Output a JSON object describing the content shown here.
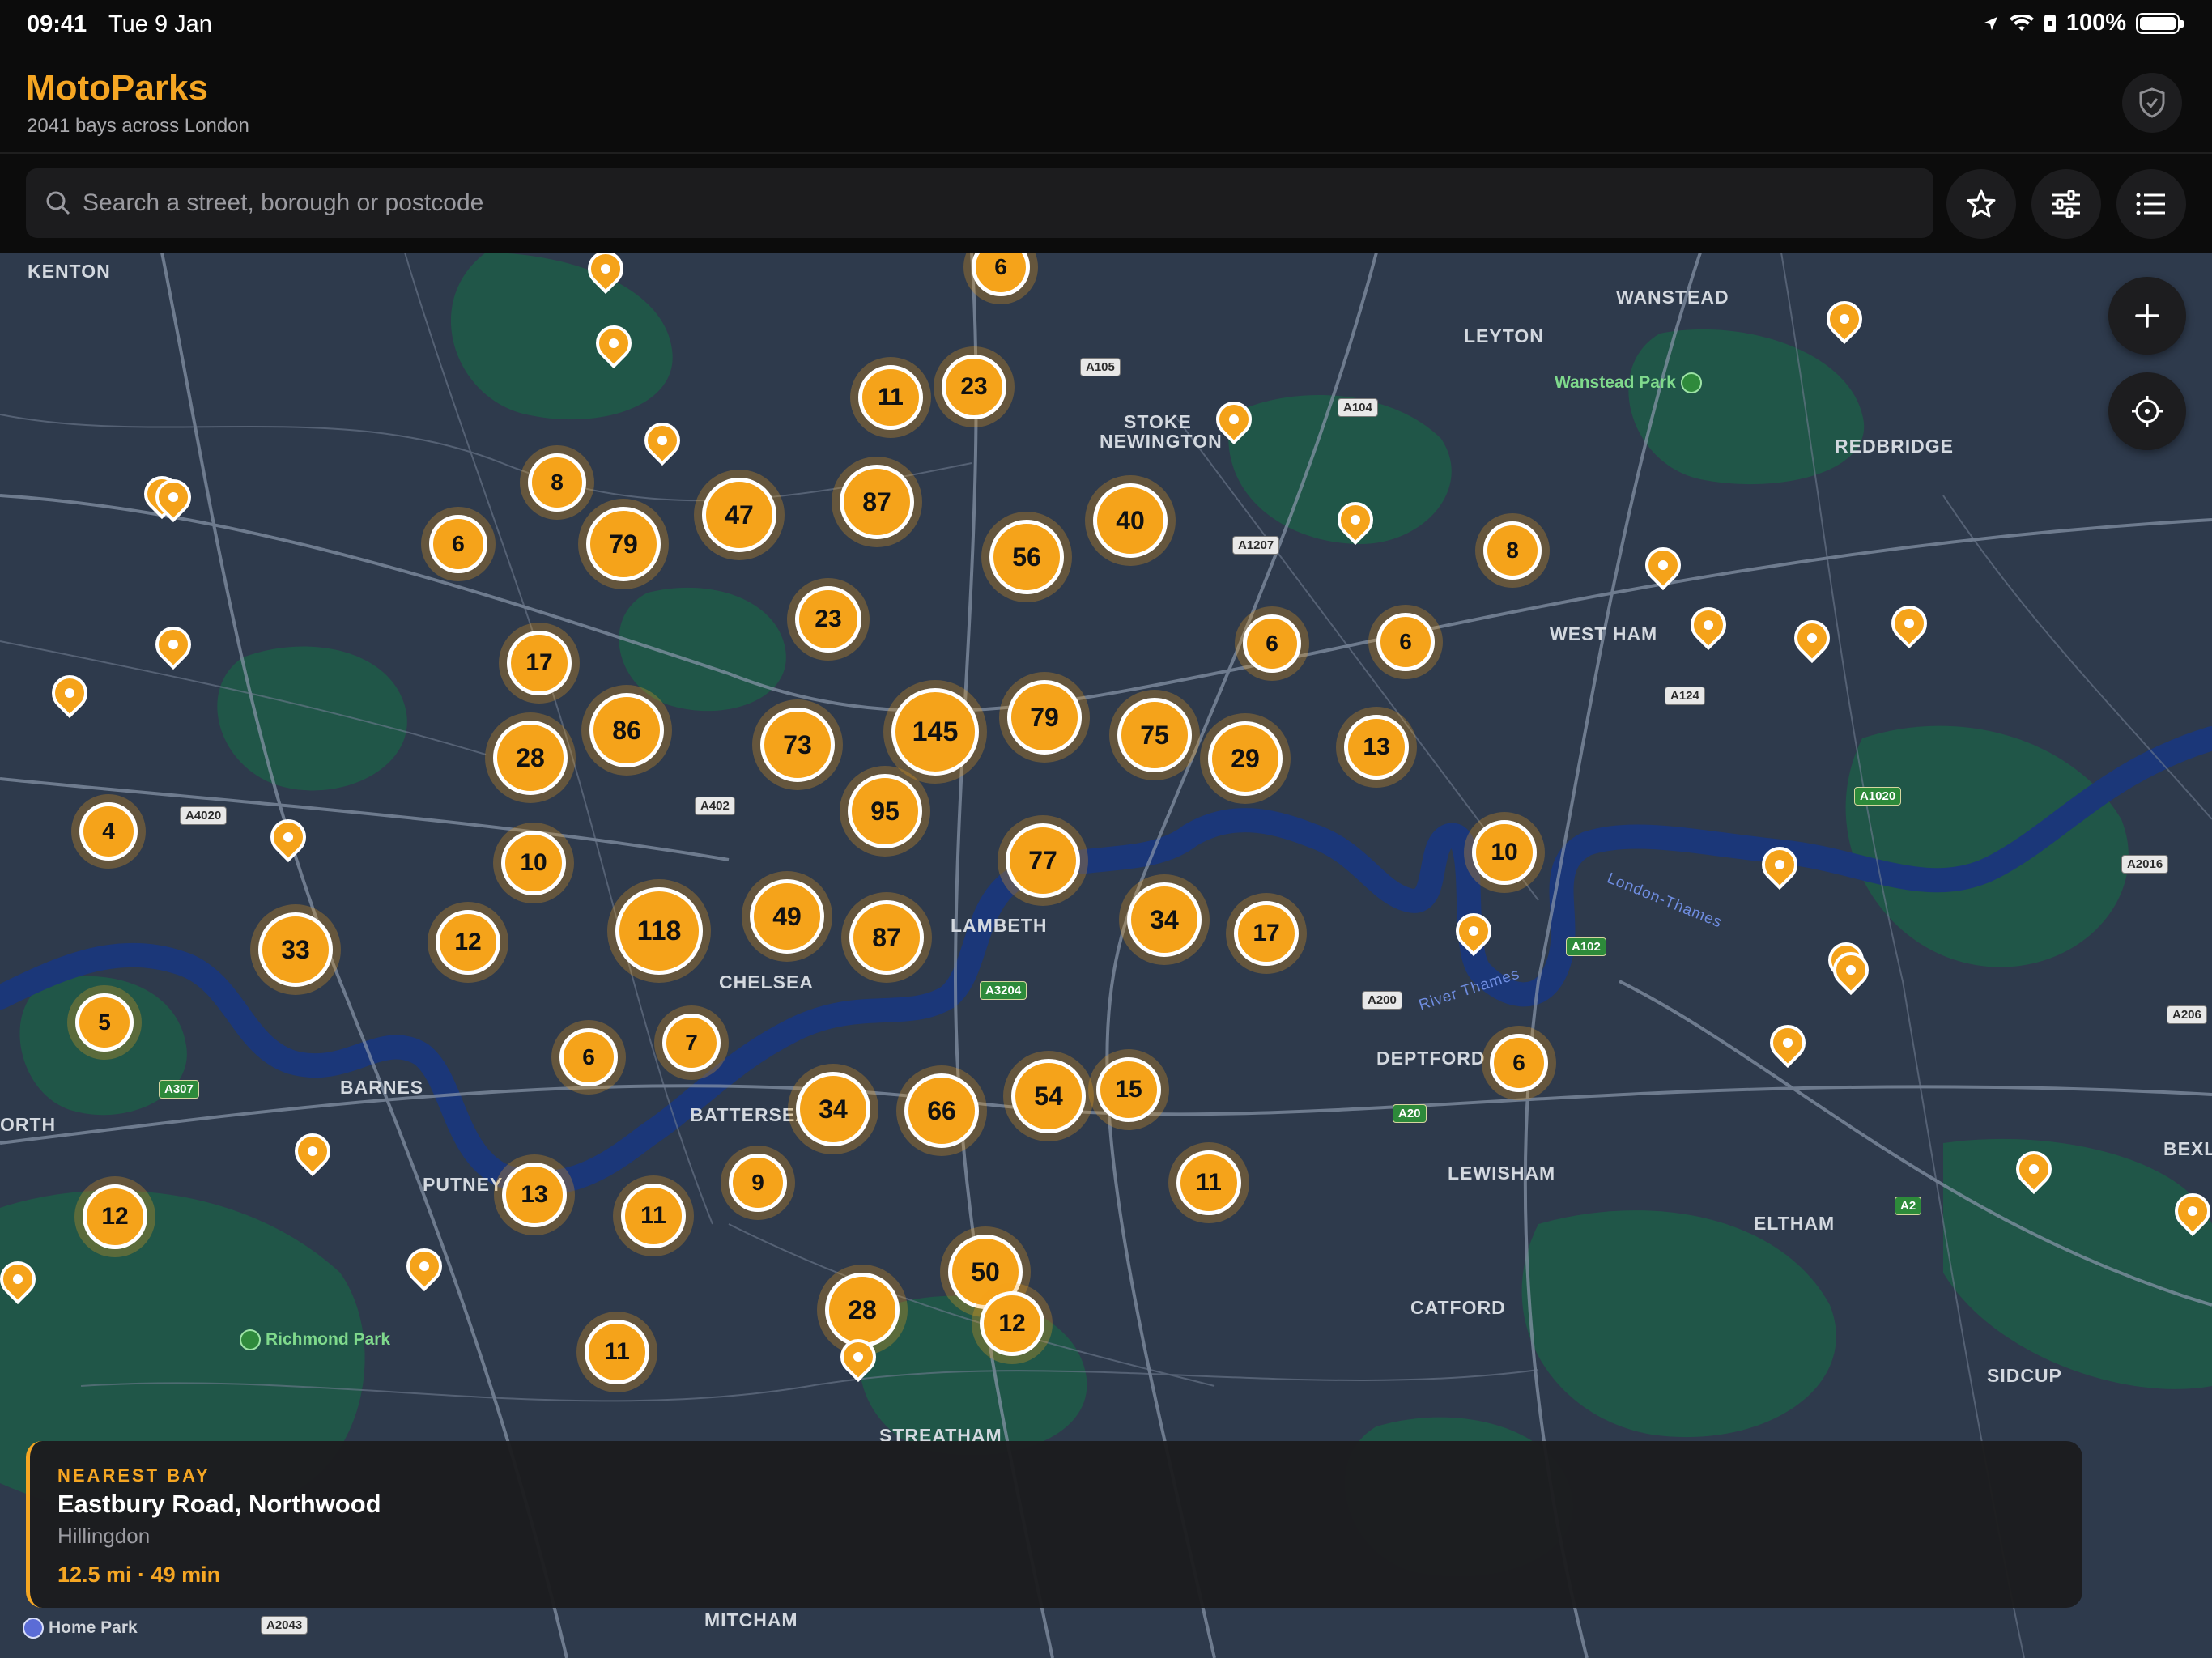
{
  "status": {
    "time": "09:41",
    "date": "Tue 9 Jan",
    "battery": "100%"
  },
  "header": {
    "title": "MotoParks",
    "subtitle": "2041 bays across London"
  },
  "search": {
    "placeholder": "Search a street, borough or postcode"
  },
  "map": {
    "labels": [
      "KENTON",
      "WANSTEAD",
      "LEYTON",
      "STOKE",
      "NEWINGTON",
      "REDBRIDGE",
      "WEST HAM",
      "LAMBETH",
      "CHELSEA",
      "BARNES",
      "BATTERSEA",
      "PUTNEY",
      "DEPTFORD",
      "LEWISHAM",
      "ELTHAM",
      "CATFORD",
      "SIDCUP",
      "STREATHAM",
      "MITCHAM",
      "BEXL",
      "ORTH"
    ],
    "parks": [
      "Wanstead Park",
      "Richmond Park",
      "Home Park"
    ],
    "river_labels": [
      "London-Thames",
      "River Thames"
    ],
    "roads": [
      "A105",
      "A104",
      "A1207",
      "A124",
      "A4020",
      "A402",
      "A3204",
      "A1020",
      "A2016",
      "A102",
      "A200",
      "A206",
      "A307",
      "A20",
      "A2",
      "A2043"
    ],
    "clusters": [
      "6",
      "11",
      "23",
      "8",
      "47",
      "87",
      "56",
      "40",
      "6",
      "79",
      "8",
      "23",
      "6",
      "6",
      "17",
      "86",
      "73",
      "145",
      "79",
      "75",
      "29",
      "13",
      "28",
      "95",
      "4",
      "10",
      "77",
      "10",
      "33",
      "12",
      "118",
      "49",
      "87",
      "34",
      "17",
      "5",
      "6",
      "7",
      "34",
      "66",
      "54",
      "15",
      "11",
      "13",
      "11",
      "9",
      "12",
      "50",
      "28",
      "12",
      "11",
      "6"
    ]
  },
  "nearest": {
    "kicker": "NEAREST BAY",
    "name": "Eastbury Road, Northwood",
    "borough": "Hillingdon",
    "distance": "12.5 mi · 49 min"
  },
  "colors": {
    "accent": "#f5a623",
    "map_base": "#2e3a4c",
    "park": "#1f6b4f",
    "water": "#1c3577"
  }
}
